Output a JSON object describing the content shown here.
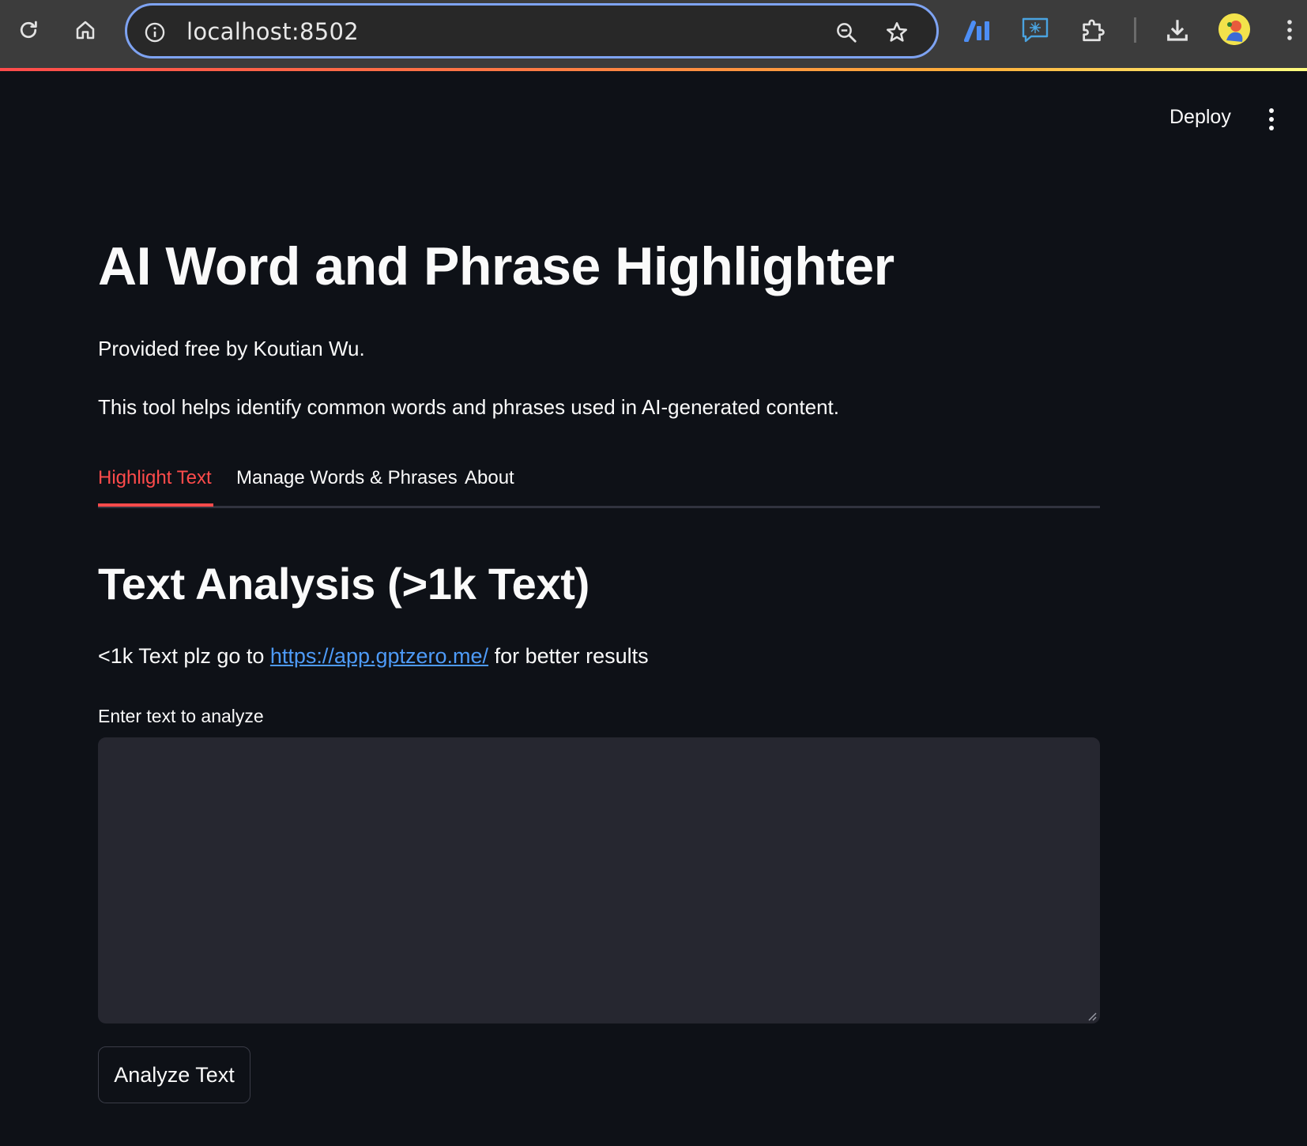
{
  "browser": {
    "url": "localhost:8502",
    "accent_color": "#7ea3f2",
    "icons": [
      "reload-icon",
      "home-icon",
      "site-info-icon",
      "zoom-icon",
      "bookmark-star-icon",
      "analytics-extension-icon",
      "ai-extension-icon",
      "extensions-puzzle-icon",
      "download-icon",
      "profile-avatar",
      "browser-menu-icon"
    ]
  },
  "header": {
    "deploy_label": "Deploy"
  },
  "main": {
    "title": "AI Word and Phrase Highlighter",
    "credit": "Provided free by Koutian Wu.",
    "description": "This tool helps identify common words and phrases used in AI-generated content.",
    "tabs": [
      {
        "label": "Highlight Text",
        "active": true
      },
      {
        "label": "Manage Words & Phrases",
        "active": false
      },
      {
        "label": "About",
        "active": false
      }
    ],
    "section_title": "Text Analysis (>1k Text)",
    "hint_before": "<1k Text plz go to ",
    "hint_link": "https://app.gptzero.me/",
    "hint_after": " for better results",
    "input_label": "Enter text to analyze",
    "input_value": "",
    "analyze_button": "Analyze Text"
  },
  "colors": {
    "background": "#0e1117",
    "accent": "#ff4b4b",
    "input_bg": "#262730",
    "link": "#4e9bf8"
  }
}
